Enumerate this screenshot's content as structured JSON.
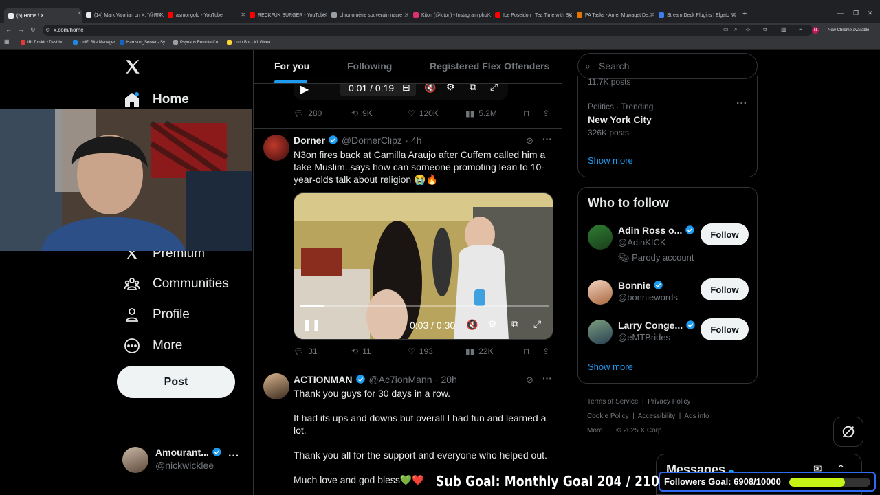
{
  "browser": {
    "tabs": [
      {
        "title": "(5) Home / X",
        "color": "#e7e9ea",
        "active": true
      },
      {
        "title": "(14) Mark Valorian on X: \"@RM...",
        "color": "#e7e9ea"
      },
      {
        "title": "asmongold - YouTube",
        "color": "#ff0000"
      },
      {
        "title": "RECKFUK BURGER - YouTube",
        "color": "#ff0000"
      },
      {
        "title": "chronomètre souverain nacre ...",
        "color": "#9aa0a6"
      },
      {
        "title": "Kiton (@kiton) • Instagram pho...",
        "color": "#e1306c"
      },
      {
        "title": "Ice Poseidon | Tea Time with By...",
        "color": "#ff0000"
      },
      {
        "title": "PA Tasks - Amer Muwaqet De...",
        "color": "#e37400"
      },
      {
        "title": "Stream Deck Plugins | Elgato M...",
        "color": "#3c7cf0"
      }
    ],
    "new_tab": "+",
    "url": "x.com/home",
    "new_chrome": "New Chrome available",
    "profile_initial": "N",
    "bookmarks": [
      {
        "label": "IRLToolkit • Dashbo...",
        "color": "#e53935"
      },
      {
        "label": "UniFi Site Manager",
        "color": "#1e88e5"
      },
      {
        "label": "Harrison_Server - Sy...",
        "color": "#1565c0"
      },
      {
        "label": "Psynaps Remote Co...",
        "color": "#9aa0a6"
      },
      {
        "label": "Lotto Bot - #1 Givea...",
        "color": "#fdd835"
      }
    ]
  },
  "nav": {
    "logo": "X",
    "items": [
      {
        "label": "Home",
        "icon": "home-icon",
        "bold": true
      },
      {
        "label": "Premium",
        "icon": "x-premium-icon"
      },
      {
        "label": "Communities",
        "icon": "communities-icon"
      },
      {
        "label": "Profile",
        "icon": "profile-icon"
      },
      {
        "label": "More",
        "icon": "more-circle-icon"
      }
    ],
    "post_label": "Post",
    "account": {
      "name": "Amourant...",
      "handle": "@nickwicklee",
      "menu": "···"
    }
  },
  "feed": {
    "tabs": [
      "For you",
      "Following",
      "Registered Flex Offenders"
    ],
    "top_video": {
      "time": "0:01 / 0:19"
    },
    "top_actions": {
      "replies": "280",
      "reposts": "9K",
      "likes": "120K",
      "views": "5.2M"
    },
    "tweets": [
      {
        "name": "Dorner",
        "handle": "@DornerClipz",
        "time": "· 4h",
        "text": "N3on fires back at Camilla Araujo after Cuffem called him a fake Muslim..says how can someone promoting lean to 10-year-olds talk about religion 😭🔥",
        "video_time": "0:03 / 0:30",
        "video_progress": 0.1,
        "actions": {
          "replies": "31",
          "reposts": "11",
          "likes": "193",
          "views": "22K"
        }
      },
      {
        "name": "ACTIONMAN",
        "handle": "@Ac7ionMann",
        "time": "· 20h",
        "lines": [
          "Thank you guys for 30 days in a row.",
          "It had its ups and downs but overall I had fun and learned a lot.",
          "Thank you all for the support and everyone who helped out.",
          "Much love and god bless💚❤️"
        ]
      }
    ]
  },
  "right": {
    "search_placeholder": "Search",
    "trend_partial": "11.7K posts",
    "trend": {
      "category": "Politics · Trending",
      "title": "New York City",
      "posts": "326K posts"
    },
    "show_more": "Show more",
    "who_title": "Who to follow",
    "who": [
      {
        "name": "Adin Ross o...",
        "handle": "@AdinKICK",
        "note": "Parody account",
        "button": "Follow"
      },
      {
        "name": "Bonnie",
        "handle": "@bonniewords",
        "button": "Follow"
      },
      {
        "name": "Larry Conge...",
        "handle": "@eMTBrides",
        "button": "Follow"
      }
    ],
    "who_show_more": "Show more",
    "footer": [
      "Terms of Service",
      "Privacy Policy",
      "Cookie Policy",
      "Accessibility",
      "Ads info",
      "More ...",
      "© 2025 X Corp."
    ]
  },
  "overlay": {
    "messages": "Messages",
    "sub_goal": "Sub Goal: Monthly Goal  204 / 210",
    "followers_goal": "Followers Goal: 6908/10000",
    "followers_progress": 0.69
  }
}
